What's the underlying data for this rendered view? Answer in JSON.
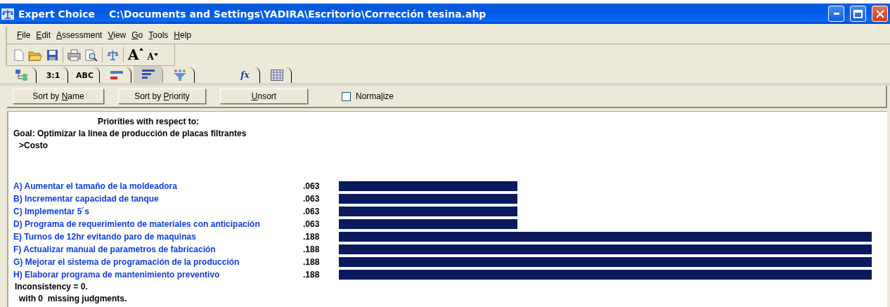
{
  "window": {
    "app_name": "Expert Choice",
    "title": "C:\\Documents and Settings\\YADIRA\\Escritorio\\Corrección tesina.ahp"
  },
  "menu": [
    {
      "key": "F",
      "after": "ile"
    },
    {
      "key": "E",
      "after": "dit"
    },
    {
      "key": "A",
      "after": "ssessment"
    },
    {
      "key": "V",
      "after": "iew"
    },
    {
      "key": "G",
      "after": "o"
    },
    {
      "key": "T",
      "after": "ools"
    },
    {
      "key": "H",
      "after": "elp"
    }
  ],
  "toolbar": [
    {
      "kind": "new"
    },
    {
      "kind": "open"
    },
    {
      "kind": "save"
    },
    {
      "kind": "separator"
    },
    {
      "kind": "print"
    },
    {
      "kind": "preview"
    },
    {
      "kind": "separator"
    },
    {
      "kind": "balance"
    },
    {
      "kind": "separator"
    },
    {
      "kind": "font-grow",
      "label": "A"
    },
    {
      "kind": "font-shrink",
      "label": "A"
    }
  ],
  "tabs": [
    {
      "kind": "tree",
      "selected": false
    },
    {
      "kind": "text",
      "label": "3:1",
      "selected": false
    },
    {
      "kind": "text",
      "label": "ABC",
      "selected": false
    },
    {
      "kind": "bars-pair",
      "selected": false
    },
    {
      "kind": "bars-sorted",
      "selected": true
    },
    {
      "kind": "funnel",
      "selected": false
    },
    {
      "kind": "formula",
      "label": "fx",
      "selected": false
    },
    {
      "kind": "grid",
      "selected": false
    }
  ],
  "buttons": [
    {
      "before": "Sort by ",
      "key": "N",
      "after": "ame"
    },
    {
      "before": "Sort by ",
      "key": "P",
      "after": "riority"
    },
    {
      "key": "U",
      "after": "nsort"
    }
  ],
  "normalize": {
    "before": "Norma",
    "key": "l",
    "after": "ize",
    "checked": false
  },
  "report": {
    "heading": "Priorities with respect to:",
    "goal": "Goal: Optimizar la línea de producción de placas filtrantes",
    "node": ">Costo",
    "alternatives": [
      {
        "label": "A) Aumentar el tamaño de la moldeadora",
        "value": ".063"
      },
      {
        "label": "B) Incrementar capacidad de tanque",
        "value": ".063"
      },
      {
        "label": "C) Implementar 5´s",
        "value": ".063"
      },
      {
        "label": "D) Programa de requerimiento de materiales con anticipación",
        "value": ".063"
      },
      {
        "label": "E) Turnos de 12hr evitando paro de maquinas",
        "value": ".188"
      },
      {
        "label": "F) Actualizar manual de parametros de fabricación",
        "value": ".188"
      },
      {
        "label": "G) Mejorar el sistema de programación de la producción",
        "value": ".188"
      },
      {
        "label": "H) Elaborar programa de mantenimiento preventivo",
        "value": ".188"
      }
    ],
    "inconsistency": "Inconsistency = 0.",
    "missing": "with 0  missing judgments."
  }
}
